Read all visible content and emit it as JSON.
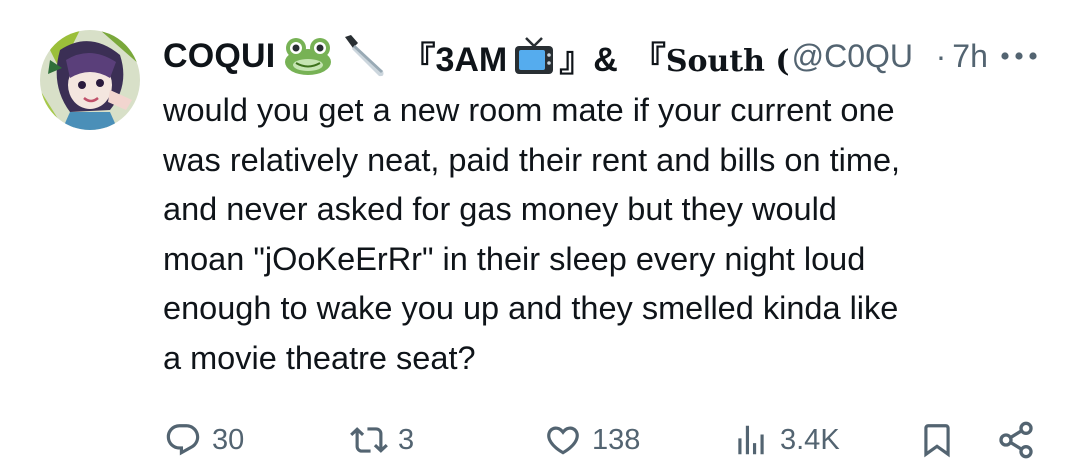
{
  "tweet": {
    "display_name": "COQUI",
    "name_emojis": [
      "frog-face-icon",
      "kitchen-knife-icon"
    ],
    "title_part1": "『3AM",
    "title_part2": "』&",
    "title_part3_open": "『",
    "title_part3_gothic": "South (",
    "handle": "@C0QU",
    "separator": "·",
    "time": "7h",
    "text": "would you get a new room mate if your current one\nwas relatively neat, paid their rent and bills on time,\nand never asked for gas money but they would\nmoan \"jOoKeErRr\" in their sleep every night loud\nenough to wake you up and they smelled kinda like\na movie theatre seat?",
    "more_icon": "more-dots-icon"
  },
  "actions": {
    "replies": {
      "icon": "reply-icon",
      "count": "30"
    },
    "reposts": {
      "icon": "repost-icon",
      "count": "3"
    },
    "likes": {
      "icon": "heart-icon",
      "count": "138"
    },
    "views": {
      "icon": "views-chart-icon",
      "count": "3.4K"
    },
    "bookmark": {
      "icon": "bookmark-icon"
    },
    "share": {
      "icon": "share-icon"
    }
  },
  "colors": {
    "text_primary": "#0f1419",
    "text_secondary": "#536471",
    "background": "#ffffff"
  }
}
